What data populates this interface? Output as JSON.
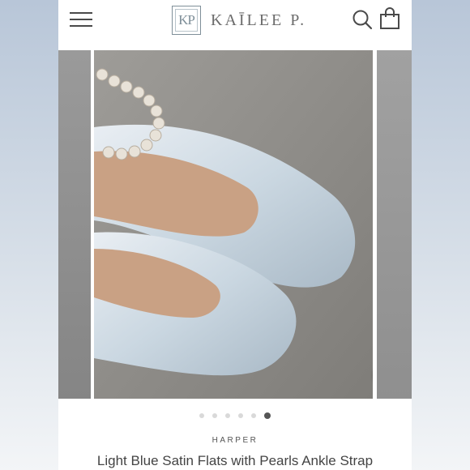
{
  "header": {
    "logo_mark": "KP",
    "logo_text": "KAĪLEE P.",
    "menu_icon": "hamburger-menu-icon",
    "search_icon": "search-icon",
    "cart_icon": "shopping-bag-icon"
  },
  "gallery": {
    "slides_total": 6,
    "active_slide": 6,
    "zoom_icon": "zoom-in-icon"
  },
  "product": {
    "brand": "HARPER",
    "title": "Light Blue Satin Flats with Pearls Ankle Strap"
  },
  "colors": {
    "accent": "#555555",
    "shoe": "#c9d6e0",
    "background": "#8d8b88"
  }
}
